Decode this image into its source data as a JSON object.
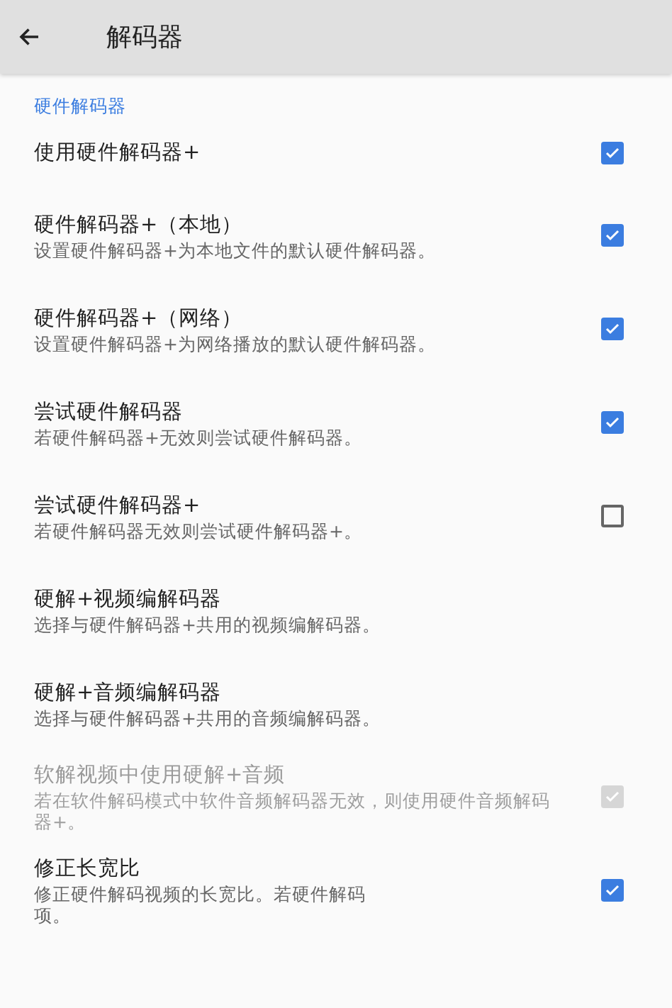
{
  "toolbar": {
    "title": "解码器"
  },
  "section": {
    "label": "硬件解码器"
  },
  "settings": [
    {
      "title": "使用硬件解码器+",
      "checked": true,
      "disabled": false
    },
    {
      "title": "硬件解码器+（本地）",
      "description": [
        "设置硬件解码器+为本地文件的默认硬件解码器。"
      ],
      "checked": true,
      "disabled": false
    },
    {
      "title": "硬件解码器+（网络）",
      "description": [
        "设置硬件解码器+为网络播放的默认硬件解码器。"
      ],
      "checked": true,
      "disabled": false
    },
    {
      "title": "尝试硬件解码器",
      "description": [
        "若硬件解码器+无效则尝试硬件解码器。"
      ],
      "checked": true,
      "disabled": false
    },
    {
      "title": "尝试硬件解码器+",
      "description": [
        "若硬件解码器无效则尝试硬件解码器+。"
      ],
      "checked": false,
      "disabled": false
    },
    {
      "title": "硬解+视频编解码器",
      "description": [
        "选择与硬件解码器+共用的视频编解码器。"
      ]
    },
    {
      "title": "硬解+音频编解码器",
      "description": [
        "选择与硬件解码器+共用的音频编解码器。"
      ]
    },
    {
      "title": "软解视频中使用硬解+音频",
      "description": [
        "若在软件解码模式中软件音频解码器无效，则使用硬件音频解码",
        "器+。"
      ],
      "checked": true,
      "disabled": true
    },
    {
      "title": "修正长宽比",
      "description": [
        "修正硬件解码视频的长宽比。若硬件解码",
        "项。"
      ],
      "checked": true,
      "disabled": false
    }
  ]
}
